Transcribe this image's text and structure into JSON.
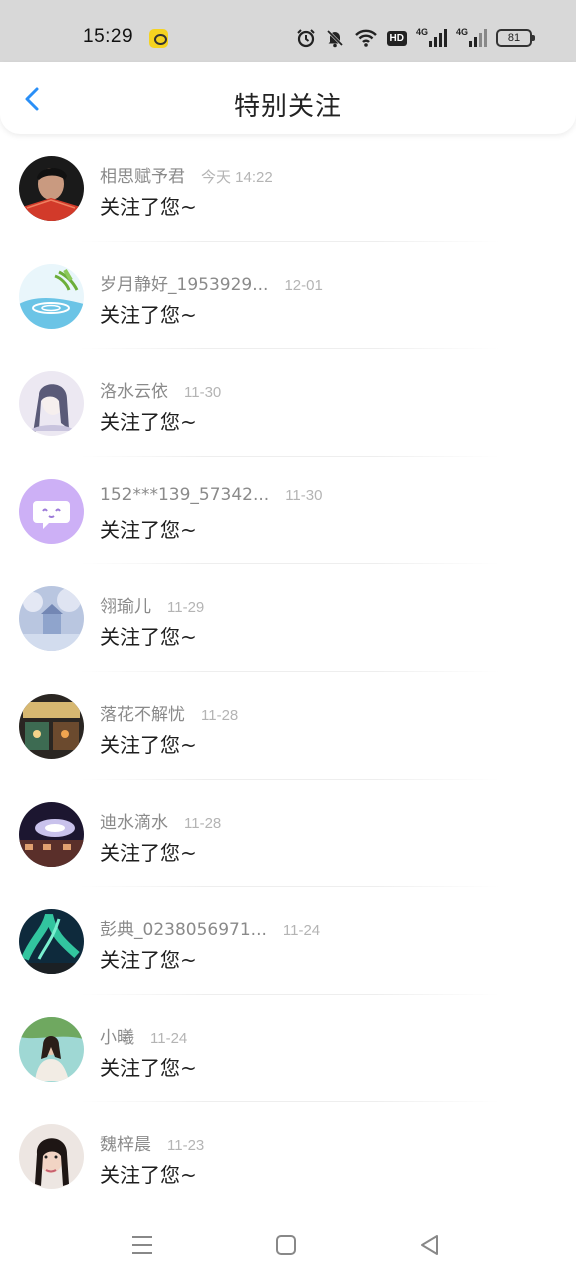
{
  "status_bar": {
    "time": "15:29",
    "icons": [
      "app-notification-icon",
      "alarm-icon",
      "mute-icon",
      "wifi-icon",
      "hd-icon",
      "signal-4g-icon",
      "signal-4g-icon"
    ],
    "hd_label": "HD",
    "network_label": "4G",
    "battery": "81"
  },
  "header": {
    "title": "特别关注"
  },
  "followers": [
    {
      "name": "相思赋予君",
      "time": "今天 14:22",
      "message": "关注了您~"
    },
    {
      "name": "岁月静好_1953929...",
      "time": "12-01",
      "message": "关注了您~"
    },
    {
      "name": "洛水云依",
      "time": "11-30",
      "message": "关注了您~"
    },
    {
      "name": "152***139_57342...",
      "time": "11-30",
      "message": "关注了您~"
    },
    {
      "name": "翎瑜儿",
      "time": "11-29",
      "message": "关注了您~"
    },
    {
      "name": "落花不解忧",
      "time": "11-28",
      "message": "关注了您~"
    },
    {
      "name": "迪水滴水",
      "time": "11-28",
      "message": "关注了您~"
    },
    {
      "name": "彭典_0238056971...",
      "time": "11-24",
      "message": "关注了您~"
    },
    {
      "name": "小曦 ",
      "time": "11-24",
      "message": "关注了您~"
    },
    {
      "name": "魏梓晨",
      "time": "11-23",
      "message": "关注了您~"
    }
  ],
  "colors": {
    "status_bar_bg": "#d8d8d8",
    "accent": "#2a8ff7",
    "name_text": "#8a8a8a",
    "time_text": "#b4b4b4"
  }
}
